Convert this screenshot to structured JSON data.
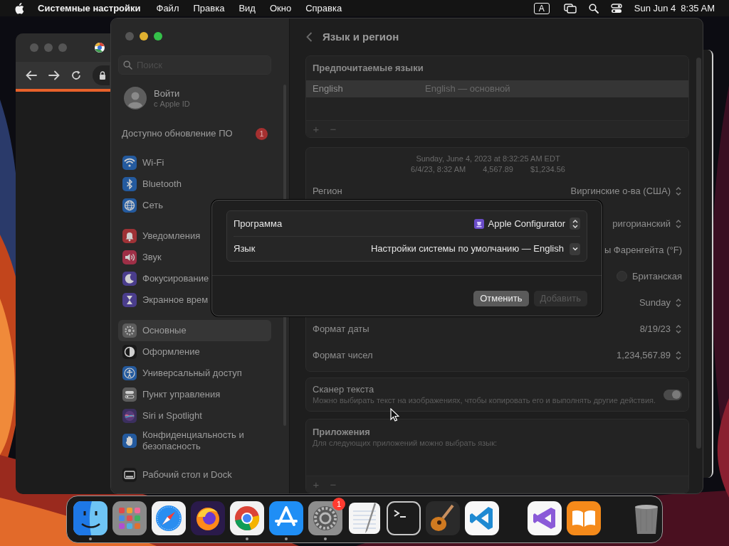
{
  "menu_bar": {
    "app_name": "Системные настройки",
    "menus": [
      "Файл",
      "Правка",
      "Вид",
      "Окно",
      "Справка"
    ],
    "input_source": "A",
    "date": "Sun Jun 4",
    "time": "8:35 AM"
  },
  "settings_window": {
    "sidebar": {
      "search": {
        "placeholder": "Поиск"
      },
      "account": {
        "title": "Войти",
        "subtitle": "с Apple ID"
      },
      "update": {
        "label": "Доступно обновление ПО",
        "badge": "1"
      },
      "groups": [
        [
          {
            "label": "Wi-Fi",
            "color": "#245a9e",
            "selected": false
          },
          {
            "label": "Bluetooth",
            "color": "#245a9e",
            "selected": false
          },
          {
            "label": "Сеть",
            "color": "#245a9e",
            "selected": false
          }
        ],
        [
          {
            "label": "Уведомления",
            "color": "#9e3236",
            "selected": false
          },
          {
            "label": "Звук",
            "color": "#9e2f46",
            "selected": false
          },
          {
            "label": "Фокусирование",
            "color": "#4a3d8c",
            "selected": false
          },
          {
            "label": "Экранное врем",
            "color": "#4a3d8c",
            "selected": false
          }
        ],
        [
          {
            "label": "Основные",
            "color": "#5c5c5c",
            "selected": true
          },
          {
            "label": "Оформление",
            "color": "#1a1a1a",
            "selected": false
          },
          {
            "label": "Универсальный доступ",
            "color": "#245a9e",
            "selected": false
          },
          {
            "label": "Пункт управления",
            "color": "#5c5c5c",
            "selected": false
          },
          {
            "label": "Siri и Spotlight",
            "color": "#3b2f5e",
            "selected": false
          },
          {
            "label": "Конфиденциальность и безопасность",
            "color": "#245a9e",
            "selected": false
          }
        ],
        [
          {
            "label": "Рабочий стол и Dock",
            "color": "#1a1a1a",
            "selected": false
          }
        ]
      ]
    },
    "content": {
      "title": "Язык и регион",
      "preferred_languages": {
        "title": "Предпочитаемые языки",
        "rows": [
          {
            "language": "English",
            "detail": "English — основной",
            "selected": true
          }
        ],
        "footer_buttons": [
          "+",
          "−"
        ]
      },
      "format_preview": {
        "line_1": "Sunday, June 4, 2023 at 8:32:25 AM EDT",
        "line_2": [
          "6/4/23, 8:32 AM",
          "4,567.89",
          "$1,234.56"
        ]
      },
      "region_rows": [
        {
          "kind": "popup",
          "label": "Регион",
          "value": "Виргинские о-ва (США)"
        },
        {
          "kind": "popup",
          "value": "ригорианский"
        },
        {
          "kind": "plain",
          "value": "ы Фаренгейта (°F)"
        },
        {
          "kind": "radio",
          "value": "Британская",
          "checked": false
        },
        {
          "kind": "popup",
          "value": "Sunday"
        },
        {
          "kind": "popup",
          "label": "Формат даты",
          "value": "8/19/23"
        },
        {
          "kind": "popup",
          "label": "Формат чисел",
          "value": "1,234,567.89"
        }
      ],
      "live_text": {
        "title": "Сканер текста",
        "description": "Можно выбирать текст на изображениях, чтобы копировать его и выполнять другие действия.",
        "on": true
      },
      "applications": {
        "title": "Приложения",
        "description": "Для следующих приложений можно выбрать язык:",
        "footer_buttons": [
          "+",
          "−"
        ]
      }
    }
  },
  "dialog": {
    "rows": [
      {
        "kind": "app",
        "label": "Программа",
        "value": "Apple Configurator"
      },
      {
        "kind": "language",
        "label": "Язык",
        "value": "Настройки системы по умолчанию — English"
      }
    ],
    "buttons": [
      {
        "label": "Отменить",
        "disabled": false
      },
      {
        "label": "Добавить",
        "disabled": true
      }
    ]
  },
  "dock": {
    "groups": [
      [
        {
          "running": true
        },
        {
          "running": false
        },
        {
          "running": false
        },
        {
          "running": false
        },
        {
          "running": true
        },
        {
          "running": true
        },
        {
          "running": true,
          "badge": "1"
        },
        {
          "running": false
        },
        {
          "running": false
        },
        {
          "running": false
        },
        {
          "running": false
        }
      ],
      [
        {
          "running": false
        },
        {
          "running": false
        }
      ],
      [
        {
          "running": false
        }
      ]
    ]
  }
}
